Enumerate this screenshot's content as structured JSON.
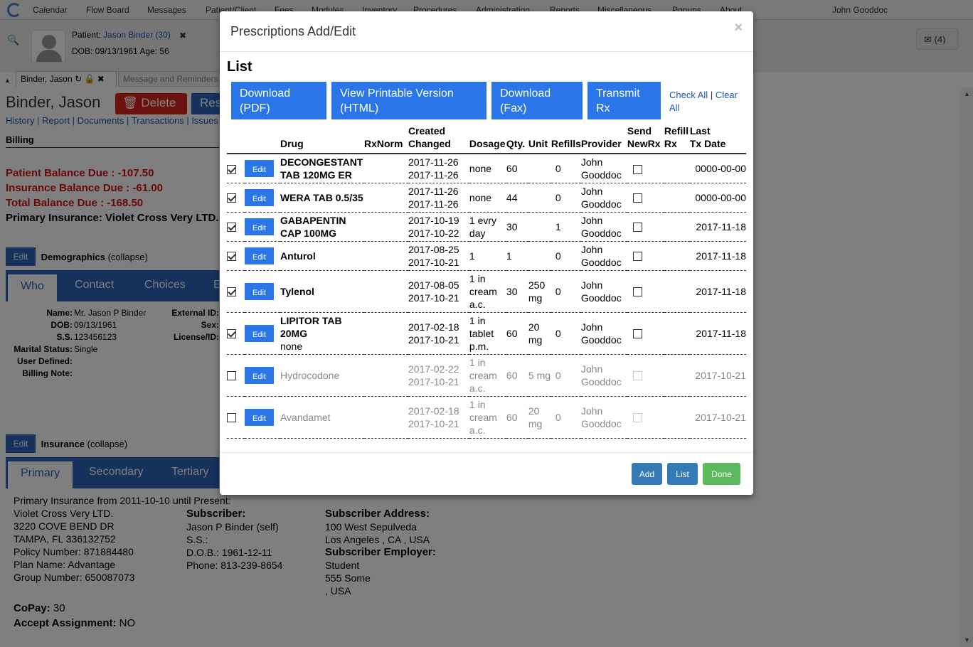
{
  "nav": {
    "menu": [
      "Calendar",
      "Flow Board",
      "Messages",
      "Patient/Client",
      "Fees",
      "Modules",
      "Inventory",
      "Procedures",
      "Administration",
      "Reports",
      "Miscellaneous",
      "Popups",
      "About"
    ],
    "user": "John Gooddoc"
  },
  "patient_bar": {
    "patient_label": "Patient:",
    "patient_name": "Jason Binder (30)",
    "dob_line": "DOB: 09/13/1961 Age: 56",
    "messages": "(4)",
    "close": "✖"
  },
  "tabs": {
    "active": "Binder, Jason",
    "other": "Message and Reminders"
  },
  "summary": {
    "name": "Binder, Jason",
    "delete_label": "Delete",
    "res_label": "Res",
    "links": "History | Report | Documents | Transactions | Issues | L",
    "billing_heading": "Billing",
    "patient_balance": "Patient Balance Due : -107.50",
    "insurance_balance": "Insurance Balance Due : -61.00",
    "total_balance": "Total Balance Due : -168.50",
    "primary_insurance": "Primary Insurance: Violet Cross Very LTD."
  },
  "demographics": {
    "edit": "Edit",
    "title": "Demographics",
    "collapse": "(collapse)",
    "tabs": [
      "Who",
      "Contact",
      "Choices",
      "E"
    ],
    "fields": [
      {
        "label": "Name:",
        "value": "Mr. Jason P Binder"
      },
      {
        "label": "DOB:",
        "value": "09/13/1961"
      },
      {
        "label": "S.S.",
        "value": "123456123"
      },
      {
        "label": "Marital Status:",
        "value": "Single"
      },
      {
        "label": "User Defined:",
        "value": ""
      },
      {
        "label": "Billing Note:",
        "value": ""
      }
    ],
    "right_labels": [
      "External ID:",
      "Sex:",
      "License/ID:"
    ]
  },
  "insurance": {
    "edit": "Edit",
    "title": "Insurance",
    "collapse": "(collapse)",
    "tabs": [
      "Primary",
      "Secondary",
      "Tertiary"
    ],
    "from": "Primary Insurance from 2011-10-10 until Present:",
    "company": "Violet Cross Very LTD.",
    "addr1": "3220 COVE BEND DR",
    "addr2": "TAMPA, FL 336132752",
    "policy": "Policy Number: 871884480",
    "plan": "Plan Name: Advantage",
    "group": "Group Number: 650087073",
    "subscriber_h": "Subscriber:",
    "subscriber": "Jason P Binder (self)",
    "ss": "S.S.:",
    "dob": "D.O.B.: 1961-12-11",
    "phone": "Phone: 813-239-8654",
    "sub_addr_h": "Subscriber Address:",
    "sub_addr1": "100 West Sepulveda",
    "sub_addr2": "Los Angeles , CA , USA",
    "employer_h": "Subscriber Employer:",
    "emp1": "Student",
    "emp2": "555 Some",
    "emp3": ", USA",
    "copay_label": "CoPay:",
    "copay": "30",
    "accept_label": "Accept Assignment:",
    "accept": "NO"
  },
  "modal": {
    "title": "Prescriptions Add/Edit",
    "close": "×",
    "list_heading": "List",
    "buttons": {
      "download_pdf": "Download (PDF)",
      "view_html": "View Printable Version (HTML)",
      "download_fax": "Download (Fax)",
      "transmit": "Transmit Rx",
      "check_all": "Check All",
      "sep": "|",
      "clear_all": "Clear All"
    },
    "headers": {
      "drug": "Drug",
      "rxnorm": "RxNorm",
      "created": "Created",
      "changed": "Changed",
      "dosage": "Dosage",
      "qty": "Qty.",
      "unit": "Unit",
      "refills": "Refills",
      "provider": "Provider",
      "send": "Send",
      "newrx": "NewRx",
      "refill": "Refill",
      "rx": "Rx",
      "last": "Last",
      "txdate": "Tx Date"
    },
    "edit_label": "Edit",
    "rows": [
      {
        "checked": true,
        "active": true,
        "drug": "DECONGESTANT TAB 120MG ER",
        "drug_note": "",
        "rxnorm": "",
        "created": "2017-11-26",
        "changed": "2017-11-26",
        "dosage": "none",
        "qty": "60",
        "unit": "",
        "refills": "0",
        "provider": "John Gooddoc",
        "last": "0000-00-00"
      },
      {
        "checked": true,
        "active": true,
        "drug": "WERA TAB 0.5/35",
        "drug_note": "",
        "rxnorm": "",
        "created": "2017-11-26",
        "changed": "2017-11-26",
        "dosage": "none",
        "qty": "44",
        "unit": "",
        "refills": "0",
        "provider": "John Gooddoc",
        "last": "0000-00-00"
      },
      {
        "checked": true,
        "active": true,
        "drug": "GABAPENTIN CAP 100MG",
        "drug_note": "",
        "rxnorm": "",
        "created": "2017-10-19",
        "changed": "2017-10-22",
        "dosage": "1 evry day",
        "qty": "30",
        "unit": "",
        "refills": "1",
        "provider": "John Gooddoc",
        "last": "2017-11-18"
      },
      {
        "checked": true,
        "active": true,
        "drug": "Anturol",
        "drug_note": "",
        "rxnorm": "",
        "created": "2017-08-25",
        "changed": "2017-10-21",
        "dosage": "1",
        "qty": "1",
        "unit": "",
        "refills": "0",
        "provider": "John Gooddoc",
        "last": "2017-11-18"
      },
      {
        "checked": true,
        "active": true,
        "drug": "Tylenol",
        "drug_note": "",
        "rxnorm": "",
        "created": "2017-08-05",
        "changed": "2017-10-21",
        "dosage": "1 in cream a.c.",
        "qty": "30",
        "unit": "250 mg",
        "refills": "0",
        "provider": "John Gooddoc",
        "last": "2017-11-18"
      },
      {
        "checked": true,
        "active": true,
        "drug": "LIPITOR TAB 20MG",
        "drug_note": "none",
        "rxnorm": "",
        "created": "2017-02-18",
        "changed": "2017-10-21",
        "dosage": "1 in tablet p.m.",
        "qty": "60",
        "unit": "20 mg",
        "refills": "0",
        "provider": "John Gooddoc",
        "last": "2017-11-18"
      },
      {
        "checked": false,
        "active": false,
        "drug": "Hydrocodone",
        "drug_note": "",
        "rxnorm": "",
        "created": "2017-02-22",
        "changed": "2017-10-21",
        "dosage": "1 in cream a.c.",
        "qty": "60",
        "unit": "5 mg",
        "refills": "0",
        "provider": "John Gooddoc",
        "last": "2017-10-21"
      },
      {
        "checked": false,
        "active": false,
        "drug": "Avandamet",
        "drug_note": "",
        "rxnorm": "",
        "created": "2017-02-18",
        "changed": "2017-10-21",
        "dosage": "1 in cream a.c.",
        "qty": "60",
        "unit": "20 mg",
        "refills": "0",
        "provider": "John Gooddoc",
        "last": "2017-10-21"
      }
    ],
    "footer": {
      "add": "Add",
      "list": "List",
      "done": "Done"
    },
    "colors": {
      "primary": "#2a75e8",
      "footer_primary": "#337ab7",
      "success": "#5cb85c"
    }
  }
}
